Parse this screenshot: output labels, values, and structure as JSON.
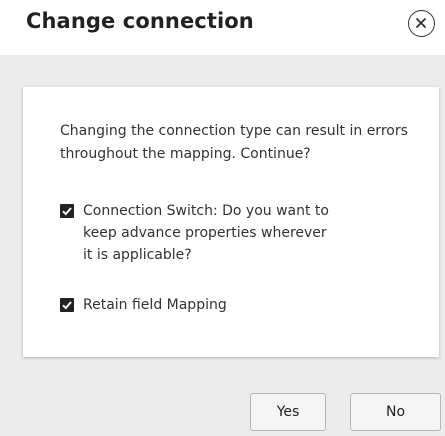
{
  "dialog": {
    "title": "Change connection",
    "message": "Changing the connection type can result in errors throughout the mapping. Continue?",
    "options": [
      {
        "label": "Connection Switch: Do you want to keep advance properties wherever it is applicable?",
        "checked": true
      },
      {
        "label": "Retain field Mapping",
        "checked": true
      }
    ],
    "buttons": {
      "yes_label": "Yes",
      "no_label": "No"
    },
    "icons": {
      "close": "close-icon",
      "checkbox": "checkmark-icon"
    },
    "colors": {
      "background": "#ececec",
      "panel": "#ffffff",
      "text": "#333333",
      "checkbox": "#222222"
    }
  }
}
